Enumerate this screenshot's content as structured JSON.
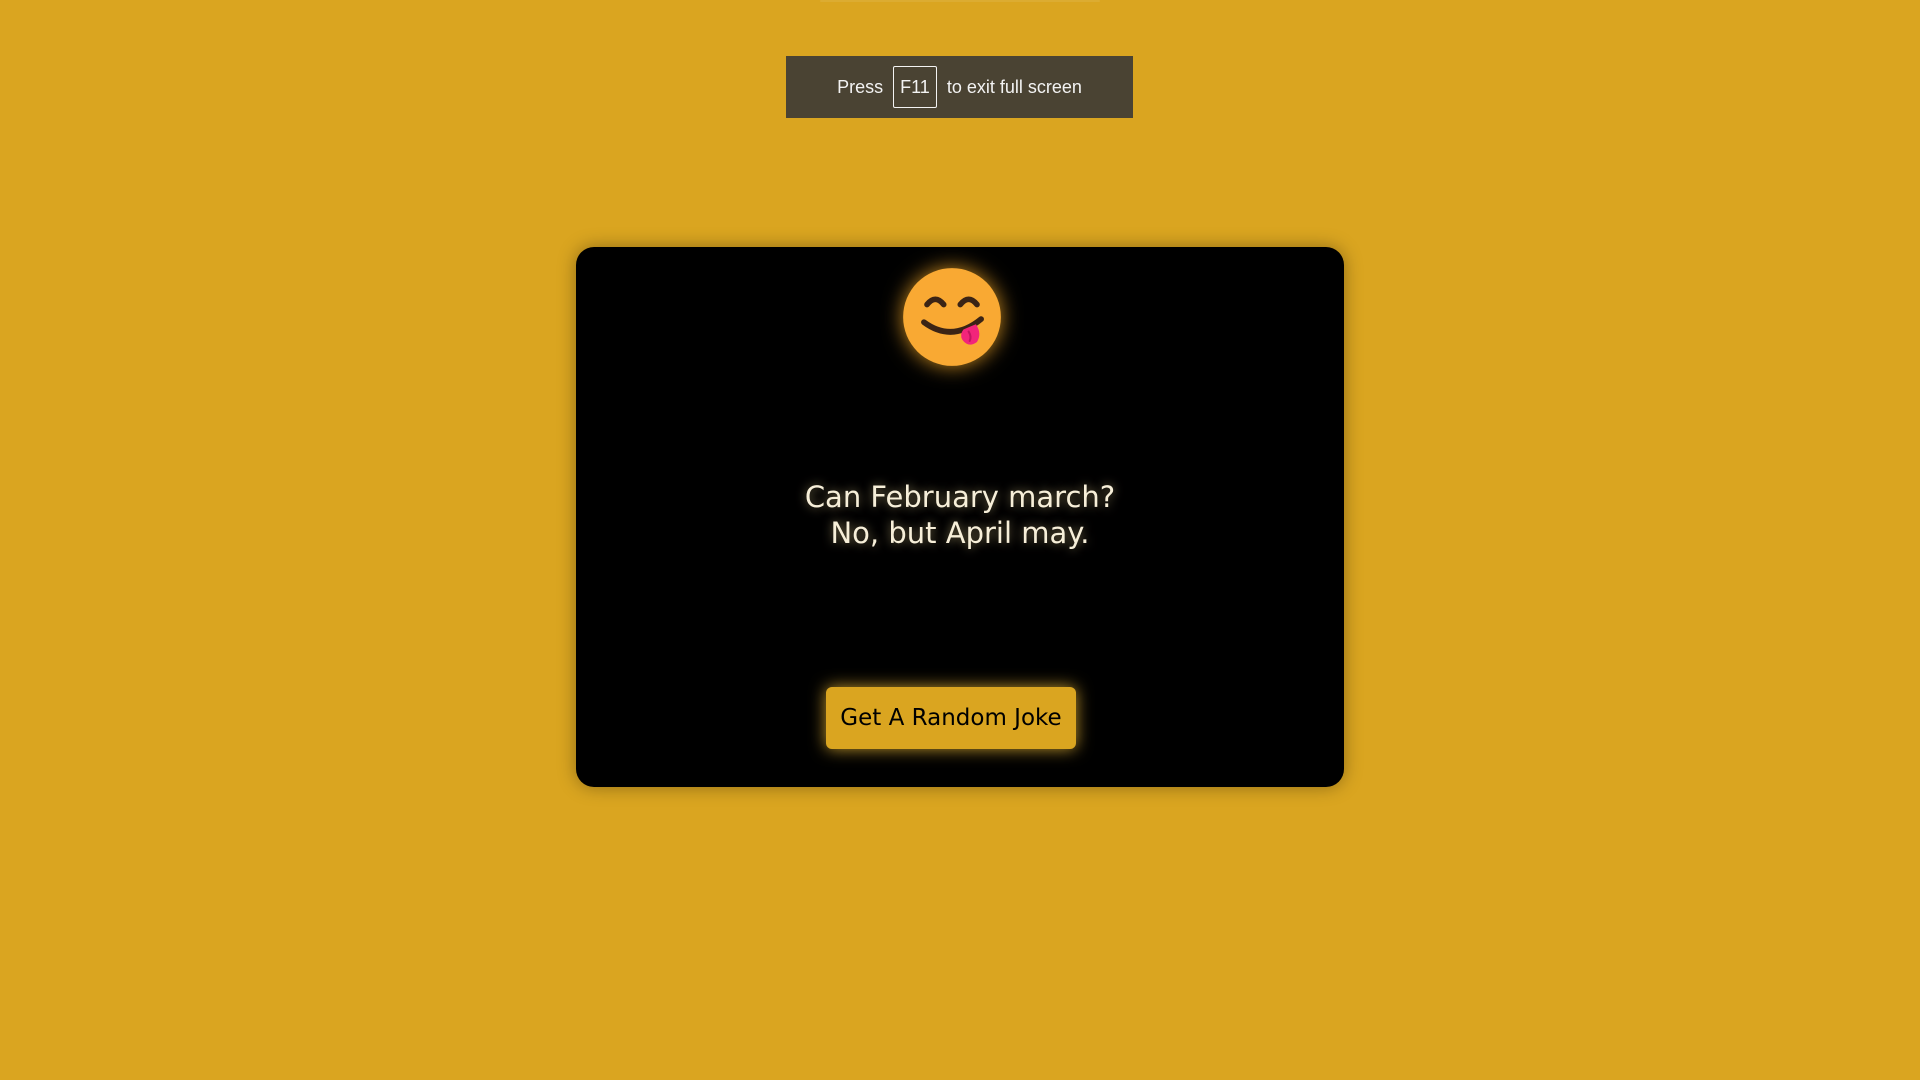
{
  "fullscreen_notice": {
    "prefix": "Press",
    "key": "F11",
    "suffix": "to exit full screen"
  },
  "joke": {
    "emoji_icon": "face-savoring-food-icon",
    "lines": [
      "Can February march?",
      "No, but April may."
    ]
  },
  "button": {
    "label": "Get A Random Joke"
  },
  "colors": {
    "background": "#daa520",
    "card": "#000000",
    "button": "#daa520",
    "text": "#f7efd9"
  }
}
